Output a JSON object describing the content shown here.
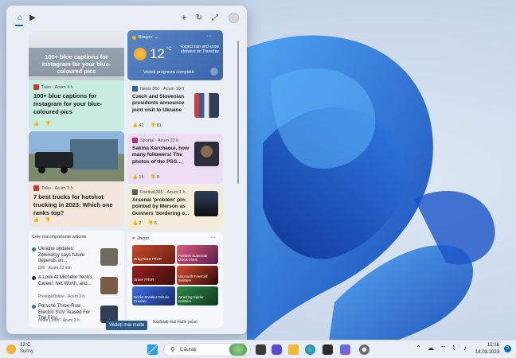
{
  "widget_cards": {
    "hero": {
      "overlay_title": "100+ blue captions for Instagram for your blue-coloured pics",
      "source": "Tuko · Acum 4 h",
      "headline": "100+ blue captions for Instagram for your blue-coloured pics"
    },
    "weather": {
      "location": "Brașov",
      "temp": "12",
      "unit": "°C",
      "forecast": "Expect rain and snow showers on Thursday",
      "link": "Vedeți prognoza completă"
    },
    "news1": {
      "source": "News 360 · Acum 10 h",
      "headline": "Czech and Slovenian presidents announce joint visit to Ukraine",
      "likes": "41",
      "dislikes": "81"
    },
    "truck": {
      "source": "Tuko · Acum 3 h",
      "headline": "7 best trucks for hotshot trucking in 2023: Which one ranks top?"
    },
    "news2": {
      "source": "Sportal · Acum 23 h",
      "headline": "Sakina Karchaoui, how many followers! The photos of the PSG...",
      "likes": "15",
      "dislikes": "9"
    },
    "news3": {
      "source": "Football365 · Acum 1 h",
      "headline": "Arsenal 'problem' pin-pointed by Merson as Gunners 'bordering o...",
      "likes": "2",
      "dislikes": "6"
    },
    "top_articles": {
      "title": "Cele mai importante articole",
      "items": [
        {
          "headline": "Ukraine updates: Zelenskyy says future depends on...",
          "source": "DW · Acum 23 min"
        },
        {
          "headline": "A Look At Michelle Yeoh's Career, Net Worth, and...",
          "source": "PrestigeOnline · Acum 3 h"
        },
        {
          "headline": "Porsche Three-Row Electric SUV Teased For The First...",
          "source": "motor1.com · Acum 3 h"
        }
      ],
      "more": "Vedeți mai multe"
    },
    "games": {
      "title": "Jocuri",
      "tiles": [
        "Drag Race FRVR",
        "Fashion Superstar Dress Them",
        "Driver FRVR",
        "Microsoft FreeCell Solitaire",
        "Bricks Breaker Deluxe Crusher",
        "Amazing Spider Solitaire"
      ],
      "explore": "Explorați mai multe jocuri"
    }
  },
  "taskbar": {
    "weather_temp": "12°C",
    "weather_desc": "Sunny",
    "search_placeholder": "Căutați",
    "time": "12:16",
    "date": "14.03.2023",
    "notif_count": "2"
  },
  "colors": {
    "accent": "#0067c0",
    "weather_card": "#3f6eb6",
    "hero_card": "#c9ece1",
    "pink_card": "#ecdcf4",
    "yellow_card": "#f4ecd9"
  }
}
